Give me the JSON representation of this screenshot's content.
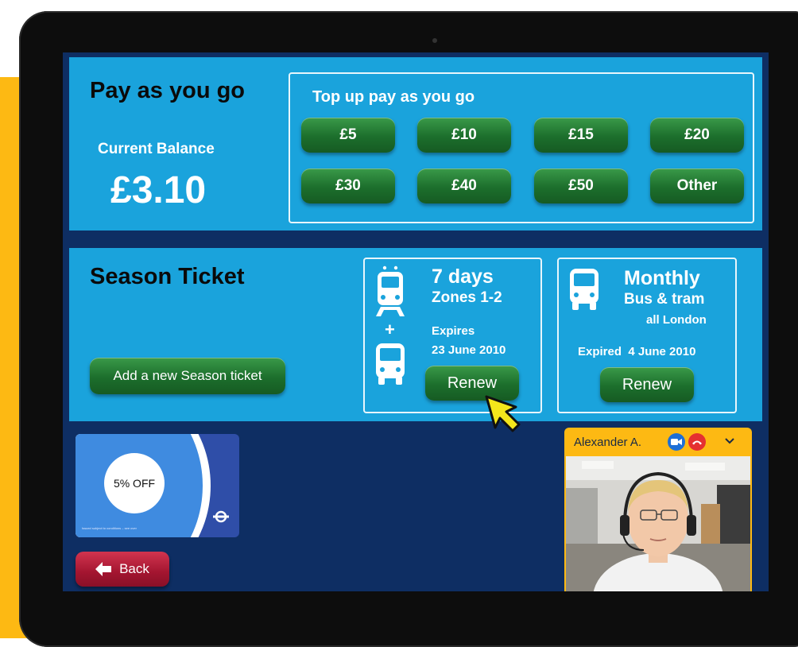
{
  "payg": {
    "title": "Pay as you go",
    "balance_label": "Current Balance",
    "balance_value": "£3.10",
    "topup_title": "Top up pay as you go",
    "amounts": [
      "£5",
      "£10",
      "£15",
      "£20",
      "£30",
      "£40",
      "£50",
      "Other"
    ]
  },
  "season": {
    "title": "Season Ticket",
    "add_button": "Add a new Season ticket",
    "ticket1": {
      "duration": "7 days",
      "zones": "Zones 1-2",
      "plus": "+",
      "expires_label": "Expires",
      "expires_date": "23 June 2010",
      "renew": "Renew"
    },
    "ticket2": {
      "duration": "Monthly",
      "type": "Bus & tram",
      "area": "all London",
      "expired": "Expired  4 June 2010",
      "renew": "Renew"
    }
  },
  "card": {
    "discount": "5% OFF",
    "fineprint": "Issued subject to conditions – see over"
  },
  "back": {
    "label": "Back"
  },
  "video_call": {
    "caller": "Alexander A.",
    "icons": [
      "video-camera-icon",
      "hang-up-icon",
      "chevron-down-icon"
    ]
  },
  "colors": {
    "screen_bg": "#0e2e63",
    "panel": "#1aa3dc",
    "green_button": "#1c6e2c",
    "back_button": "#a31530",
    "accent_yellow": "#fdb913"
  }
}
